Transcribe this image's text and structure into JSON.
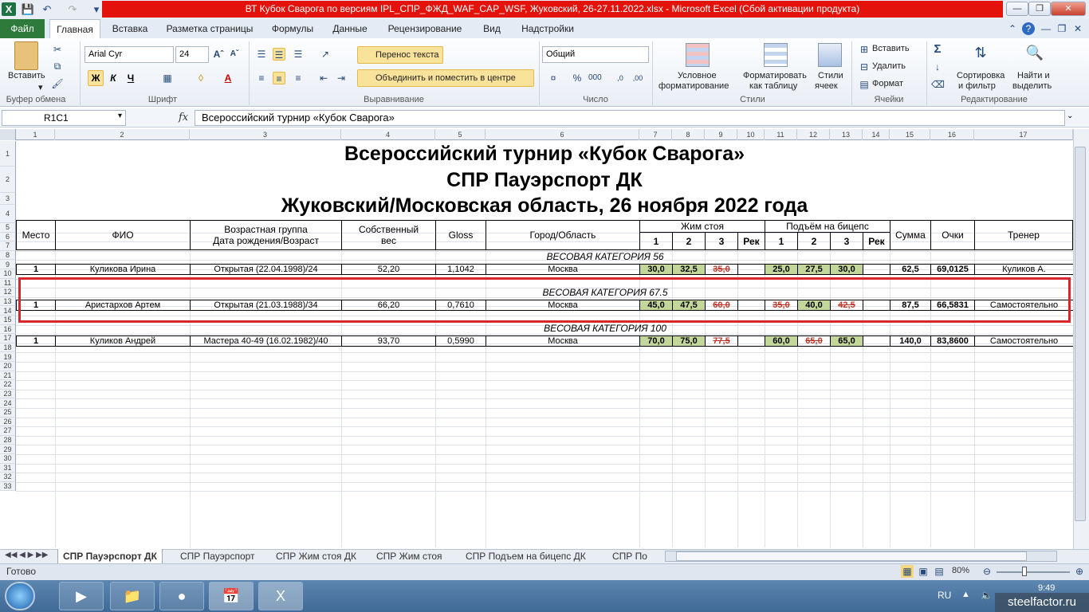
{
  "window": {
    "title": "ВТ Кубок Сварога по версиям IPL_СПР_ФЖД_WAF_CAP_WSF, Жуковский, 26-27.11.2022.xlsx - Microsoft Excel (Сбой активации продукта)"
  },
  "ribbon_tabs": [
    "Файл",
    "Главная",
    "Вставка",
    "Разметка страницы",
    "Формулы",
    "Данные",
    "Рецензирование",
    "Вид",
    "Надстройки"
  ],
  "ribbon": {
    "paste": "Вставить",
    "clipboard": "Буфер обмена",
    "font_name": "Arial Cyr",
    "font_size": "24",
    "bold": "Ж",
    "italic": "К",
    "underline": "Ч",
    "font_group": "Шрифт",
    "wrap_text": "Перенос текста",
    "merge_center": "Объединить и поместить в центре",
    "alignment_group": "Выравнивание",
    "number_format": "Общий",
    "number_group": "Число",
    "cond_format_1": "Условное",
    "cond_format_2": "форматирование",
    "format_table_1": "Форматировать",
    "format_table_2": "как таблицу",
    "cell_styles_1": "Стили",
    "cell_styles_2": "ячеек",
    "styles_group": "Стили",
    "insert": "Вставить",
    "delete": "Удалить",
    "format": "Формат",
    "cells_group": "Ячейки",
    "sort_1": "Сортировка",
    "sort_2": "и фильтр",
    "find_1": "Найти и",
    "find_2": "выделить",
    "editing_group": "Редактирование"
  },
  "formula_bar": {
    "name_box": "R1C1",
    "fx": "fx",
    "content": "Всероссийский турнир «Кубок Сварога»"
  },
  "columns": [
    "1",
    "2",
    "3",
    "4",
    "5",
    "6",
    "7",
    "8",
    "9",
    "10",
    "11",
    "12",
    "13",
    "14",
    "15",
    "16",
    "17"
  ],
  "rows": [
    "1",
    "2",
    "3",
    "4",
    "5",
    "6",
    "7",
    "8",
    "9",
    "10",
    "11",
    "12",
    "13",
    "14",
    "15",
    "16",
    "17",
    "18",
    "19",
    "20",
    "21",
    "22",
    "23",
    "24",
    "25",
    "26",
    "27",
    "28",
    "29",
    "30",
    "31",
    "32",
    "33"
  ],
  "sheet": {
    "title1": "Всероссийский турнир «Кубок Сварога»",
    "title2": "СПР Пауэрспорт ДК",
    "title3": "Жуковский/Московская область, 26 ноября 2022 года",
    "headers": {
      "place": "Место",
      "fio": "ФИО",
      "age_group_1": "Возрастная группа",
      "age_group_2": "Дата рождения/Возраст",
      "weight_1": "Собственный",
      "weight_2": "вес",
      "gloss": "Gloss",
      "city": "Город/Область",
      "bench": "Жим стоя",
      "curl": "Подъём на бицепс",
      "a1": "1",
      "a2": "2",
      "a3": "3",
      "rec": "Рек",
      "total": "Сумма",
      "points": "Очки",
      "coach": "Тренер"
    },
    "cat56": "ВЕСОВАЯ КАТЕГОРИЯ  56",
    "cat675": "ВЕСОВАЯ КАТЕГОРИЯ  67.5",
    "cat100": "ВЕСОВАЯ КАТЕГОРИЯ  100",
    "athletes": [
      {
        "place": "1",
        "fio": "Куликова Ирина",
        "group": "Открытая (22.04.1998)/24",
        "weight": "52,20",
        "gloss": "1,1042",
        "city": "Москва",
        "b1": "30,0",
        "b2": "32,5",
        "b3": "35,0",
        "br": "",
        "c1": "25,0",
        "c2": "27,5",
        "c3": "30,0",
        "cr": "",
        "total": "62,5",
        "points": "69,0125",
        "coach": "Куликов А."
      },
      {
        "place": "1",
        "fio": "Аристархов Артем",
        "group": "Открытая (21.03.1988)/34",
        "weight": "66,20",
        "gloss": "0,7610",
        "city": "Москва",
        "b1": "45,0",
        "b2": "47,5",
        "b3": "60,0",
        "br": "",
        "c1": "35,0",
        "c2": "40,0",
        "c3": "42,5",
        "cr": "",
        "total": "87,5",
        "points": "66,5831",
        "coach": "Самостоятельно"
      },
      {
        "place": "1",
        "fio": "Куликов Андрей",
        "group": "Мастера 40-49 (16.02.1982)/40",
        "weight": "93,70",
        "gloss": "0,5990",
        "city": "Москва",
        "b1": "70,0",
        "b2": "75,0",
        "b3": "77,5",
        "br": "",
        "c1": "60,0",
        "c2": "65,0",
        "c3": "65,0",
        "cr": "",
        "total": "140,0",
        "points": "83,8600",
        "coach": "Самостоятельно"
      }
    ]
  },
  "sheet_tabs": [
    "СПР Пауэрспорт ДК",
    "СПР Пауэрспорт",
    "СПР Жим стоя ДК",
    "СПР Жим стоя",
    "СПР Подъем на бицепс ДК",
    "СПР По"
  ],
  "status": {
    "ready": "Готово",
    "zoom": "80%"
  },
  "taskbar": {
    "lang": "RU",
    "time": "9:49",
    "watermark": "steelfactor.ru"
  }
}
